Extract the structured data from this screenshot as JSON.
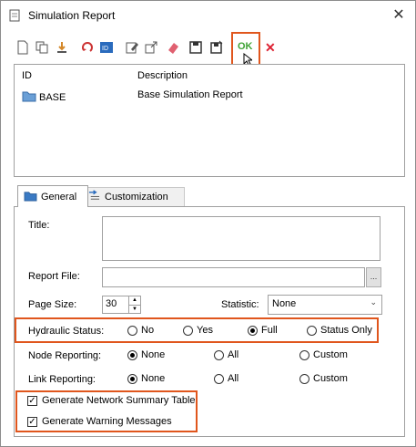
{
  "window": {
    "title": "Simulation Report",
    "close_glyph": "✕"
  },
  "toolbar": {
    "icons": [
      "new-icon",
      "copy-icon",
      "import-icon",
      "refresh-icon",
      "id-icon",
      "edit-icon",
      "export-icon",
      "eraser-icon",
      "save-icon",
      "save-as-icon",
      "ok-icon",
      "delete-icon"
    ],
    "ok_label": "OK",
    "delete_glyph": "✕",
    "highlight_color": "#e0561d"
  },
  "list": {
    "columns": [
      "ID",
      "Description"
    ],
    "rows": [
      {
        "id": "BASE",
        "description": "Base Simulation Report"
      }
    ]
  },
  "tabs": [
    {
      "label": "General",
      "active": true
    },
    {
      "label": "Customization",
      "active": false
    }
  ],
  "form": {
    "title_label": "Title:",
    "title_value": "",
    "report_file_label": "Report File:",
    "report_file_value": "",
    "browse_label": "...",
    "page_size_label": "Page Size:",
    "page_size_value": "30",
    "statistic_label": "Statistic:",
    "statistic_value": "None",
    "hydraulic_status": {
      "label": "Hydraulic Status:",
      "options": [
        "No",
        "Yes",
        "Full",
        "Status Only"
      ],
      "selected": "Full"
    },
    "node_reporting": {
      "label": "Node Reporting:",
      "options": [
        "None",
        "All",
        "Custom"
      ],
      "selected": "None"
    },
    "link_reporting": {
      "label": "Link Reporting:",
      "options": [
        "None",
        "All",
        "Custom"
      ],
      "selected": "None"
    },
    "generate_summary": {
      "label": "Generate Network Summary Table",
      "checked": true
    },
    "generate_warnings": {
      "label": "Generate Warning Messages",
      "checked": true
    }
  }
}
